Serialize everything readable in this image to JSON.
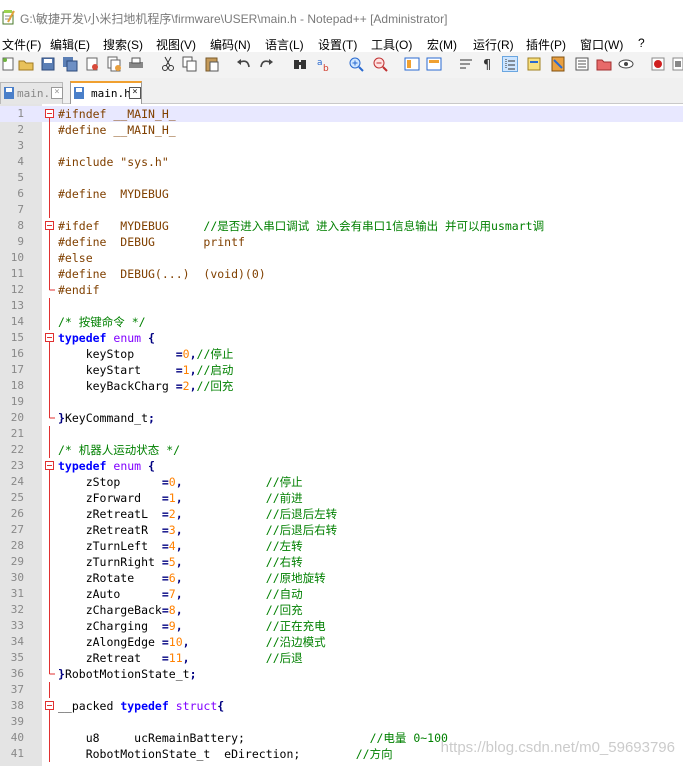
{
  "window": {
    "title": "G:\\敏捷开发\\小米扫地机程序\\firmware\\USER\\main.h - Notepad++ [Administrator]"
  },
  "menu": [
    "文件(F)",
    "编辑(E)",
    "搜索(S)",
    "视图(V)",
    "编码(N)",
    "语言(L)",
    "设置(T)",
    "工具(O)",
    "宏(M)",
    "运行(R)",
    "插件(P)",
    "窗口(W)",
    "?"
  ],
  "toolbar": {
    "icons": [
      "new-file-icon",
      "open-file-icon",
      "save-icon",
      "save-all-icon",
      "close-icon",
      "close-all-icon",
      "print-icon",
      "cut-icon",
      "copy-icon",
      "paste-icon",
      "undo-icon",
      "redo-icon",
      "find-icon",
      "replace-icon",
      "zoom-in-icon",
      "zoom-out-icon",
      "sync-v-icon",
      "sync-h-icon",
      "word-wrap-icon",
      "show-all-chars-icon",
      "indent-guide-icon",
      "user-lang-icon",
      "doc-map-icon",
      "function-list-icon",
      "folder-workspace-icon",
      "monitor-icon",
      "record-macro-icon",
      "stop-macro-icon"
    ]
  },
  "tabs": [
    {
      "label": "main.c",
      "active": false
    },
    {
      "label": "main.h",
      "active": true
    }
  ],
  "editor": {
    "current_line": 1,
    "lines": [
      {
        "n": "1",
        "fold": "box",
        "tokens": [
          [
            "pp",
            "#ifndef __MAIN_H_"
          ]
        ]
      },
      {
        "n": "2",
        "fold": "line",
        "tokens": [
          [
            "pp",
            "#define __MAIN_H_"
          ]
        ]
      },
      {
        "n": "3",
        "fold": "line",
        "tokens": []
      },
      {
        "n": "4",
        "fold": "line",
        "tokens": [
          [
            "pp",
            "#include \"sys.h\""
          ]
        ]
      },
      {
        "n": "5",
        "fold": "line",
        "tokens": []
      },
      {
        "n": "6",
        "fold": "line",
        "tokens": [
          [
            "pp",
            "#define  MYDEBUG"
          ]
        ]
      },
      {
        "n": "7",
        "fold": "line",
        "tokens": []
      },
      {
        "n": "8",
        "fold": "box",
        "tokens": [
          [
            "pp",
            "#ifdef   MYDEBUG     "
          ],
          [
            "cm",
            "//是否进入串口调试 进入会有串口1信息输出 并可以用usmart调"
          ]
        ]
      },
      {
        "n": "9",
        "fold": "line",
        "tokens": [
          [
            "pp",
            "#define  DEBUG       printf"
          ]
        ]
      },
      {
        "n": "10",
        "fold": "line",
        "tokens": [
          [
            "pp",
            "#else"
          ]
        ]
      },
      {
        "n": "11",
        "fold": "line",
        "tokens": [
          [
            "pp",
            "#define  DEBUG(...)  (void)(0)"
          ]
        ]
      },
      {
        "n": "12",
        "fold": "end",
        "tokens": [
          [
            "pp",
            "#endif"
          ]
        ]
      },
      {
        "n": "13",
        "fold": "line",
        "tokens": []
      },
      {
        "n": "14",
        "fold": "line",
        "tokens": [
          [
            "cm",
            "/* 按键命令 */"
          ]
        ]
      },
      {
        "n": "15",
        "fold": "box",
        "tokens": [
          [
            "kw",
            "typedef"
          ],
          [
            "id",
            " "
          ],
          [
            "type",
            "enum"
          ],
          [
            "id",
            " "
          ],
          [
            "op",
            "{"
          ]
        ]
      },
      {
        "n": "16",
        "fold": "line",
        "tokens": [
          [
            "id",
            "    keyStop      "
          ],
          [
            "op",
            "="
          ],
          [
            "num",
            "0"
          ],
          [
            "op",
            ","
          ],
          [
            "cm",
            "//停止"
          ]
        ]
      },
      {
        "n": "17",
        "fold": "line",
        "tokens": [
          [
            "id",
            "    keyStart     "
          ],
          [
            "op",
            "="
          ],
          [
            "num",
            "1"
          ],
          [
            "op",
            ","
          ],
          [
            "cm",
            "//启动"
          ]
        ]
      },
      {
        "n": "18",
        "fold": "line",
        "tokens": [
          [
            "id",
            "    keyBackCharg "
          ],
          [
            "op",
            "="
          ],
          [
            "num",
            "2"
          ],
          [
            "op",
            ","
          ],
          [
            "cm",
            "//回充"
          ]
        ]
      },
      {
        "n": "19",
        "fold": "line",
        "tokens": []
      },
      {
        "n": "20",
        "fold": "end",
        "tokens": [
          [
            "op",
            "}"
          ],
          [
            "id",
            "KeyCommand_t"
          ],
          [
            "op",
            ";"
          ]
        ]
      },
      {
        "n": "21",
        "fold": "line",
        "tokens": []
      },
      {
        "n": "22",
        "fold": "line",
        "tokens": [
          [
            "cm",
            "/* 机器人运动状态 */"
          ]
        ]
      },
      {
        "n": "23",
        "fold": "box",
        "tokens": [
          [
            "kw",
            "typedef"
          ],
          [
            "id",
            " "
          ],
          [
            "type",
            "enum"
          ],
          [
            "id",
            " "
          ],
          [
            "op",
            "{"
          ]
        ]
      },
      {
        "n": "24",
        "fold": "line",
        "tokens": [
          [
            "id",
            "    zStop      "
          ],
          [
            "op",
            "="
          ],
          [
            "num",
            "0"
          ],
          [
            "op",
            ","
          ],
          [
            "id",
            "            "
          ],
          [
            "cm",
            "//停止"
          ]
        ]
      },
      {
        "n": "25",
        "fold": "line",
        "tokens": [
          [
            "id",
            "    zForward   "
          ],
          [
            "op",
            "="
          ],
          [
            "num",
            "1"
          ],
          [
            "op",
            ","
          ],
          [
            "id",
            "            "
          ],
          [
            "cm",
            "//前进"
          ]
        ]
      },
      {
        "n": "26",
        "fold": "line",
        "tokens": [
          [
            "id",
            "    zRetreatL  "
          ],
          [
            "op",
            "="
          ],
          [
            "num",
            "2"
          ],
          [
            "op",
            ","
          ],
          [
            "id",
            "            "
          ],
          [
            "cm",
            "//后退后左转"
          ]
        ]
      },
      {
        "n": "27",
        "fold": "line",
        "tokens": [
          [
            "id",
            "    zRetreatR  "
          ],
          [
            "op",
            "="
          ],
          [
            "num",
            "3"
          ],
          [
            "op",
            ","
          ],
          [
            "id",
            "            "
          ],
          [
            "cm",
            "//后退后右转"
          ]
        ]
      },
      {
        "n": "28",
        "fold": "line",
        "tokens": [
          [
            "id",
            "    zTurnLeft  "
          ],
          [
            "op",
            "="
          ],
          [
            "num",
            "4"
          ],
          [
            "op",
            ","
          ],
          [
            "id",
            "            "
          ],
          [
            "cm",
            "//左转"
          ]
        ]
      },
      {
        "n": "29",
        "fold": "line",
        "tokens": [
          [
            "id",
            "    zTurnRight "
          ],
          [
            "op",
            "="
          ],
          [
            "num",
            "5"
          ],
          [
            "op",
            ","
          ],
          [
            "id",
            "            "
          ],
          [
            "cm",
            "//右转"
          ]
        ]
      },
      {
        "n": "30",
        "fold": "line",
        "tokens": [
          [
            "id",
            "    zRotate    "
          ],
          [
            "op",
            "="
          ],
          [
            "num",
            "6"
          ],
          [
            "op",
            ","
          ],
          [
            "id",
            "            "
          ],
          [
            "cm",
            "//原地旋转"
          ]
        ]
      },
      {
        "n": "31",
        "fold": "line",
        "tokens": [
          [
            "id",
            "    zAuto      "
          ],
          [
            "op",
            "="
          ],
          [
            "num",
            "7"
          ],
          [
            "op",
            ","
          ],
          [
            "id",
            "            "
          ],
          [
            "cm",
            "//自动"
          ]
        ]
      },
      {
        "n": "32",
        "fold": "line",
        "tokens": [
          [
            "id",
            "    zChargeBack"
          ],
          [
            "op",
            "="
          ],
          [
            "num",
            "8"
          ],
          [
            "op",
            ","
          ],
          [
            "id",
            "            "
          ],
          [
            "cm",
            "//回充"
          ]
        ]
      },
      {
        "n": "33",
        "fold": "line",
        "tokens": [
          [
            "id",
            "    zCharging  "
          ],
          [
            "op",
            "="
          ],
          [
            "num",
            "9"
          ],
          [
            "op",
            ","
          ],
          [
            "id",
            "            "
          ],
          [
            "cm",
            "//正在充电"
          ]
        ]
      },
      {
        "n": "34",
        "fold": "line",
        "tokens": [
          [
            "id",
            "    zAlongEdge "
          ],
          [
            "op",
            "="
          ],
          [
            "num",
            "10"
          ],
          [
            "op",
            ","
          ],
          [
            "id",
            "           "
          ],
          [
            "cm",
            "//沿边模式"
          ]
        ]
      },
      {
        "n": "35",
        "fold": "line",
        "tokens": [
          [
            "id",
            "    zRetreat   "
          ],
          [
            "op",
            "="
          ],
          [
            "num",
            "11"
          ],
          [
            "op",
            ","
          ],
          [
            "id",
            "           "
          ],
          [
            "cm",
            "//后退"
          ]
        ]
      },
      {
        "n": "36",
        "fold": "end",
        "tokens": [
          [
            "op",
            "}"
          ],
          [
            "id",
            "RobotMotionState_t"
          ],
          [
            "op",
            ";"
          ]
        ]
      },
      {
        "n": "37",
        "fold": "line",
        "tokens": []
      },
      {
        "n": "38",
        "fold": "box",
        "tokens": [
          [
            "id",
            "__packed "
          ],
          [
            "kw",
            "typedef"
          ],
          [
            "id",
            " "
          ],
          [
            "type",
            "struct"
          ],
          [
            "op",
            "{"
          ]
        ]
      },
      {
        "n": "39",
        "fold": "line",
        "tokens": []
      },
      {
        "n": "40",
        "fold": "line",
        "tokens": [
          [
            "id",
            "    u8     ucRemainBattery;                  "
          ],
          [
            "cm",
            "//电量 0~100"
          ]
        ]
      },
      {
        "n": "41",
        "fold": "line",
        "tokens": [
          [
            "id",
            "    RobotMotionState_t  eDirection;        "
          ],
          [
            "cm",
            "//方向"
          ]
        ]
      }
    ]
  },
  "watermark": "https://blog.csdn.net/m0_59693796"
}
